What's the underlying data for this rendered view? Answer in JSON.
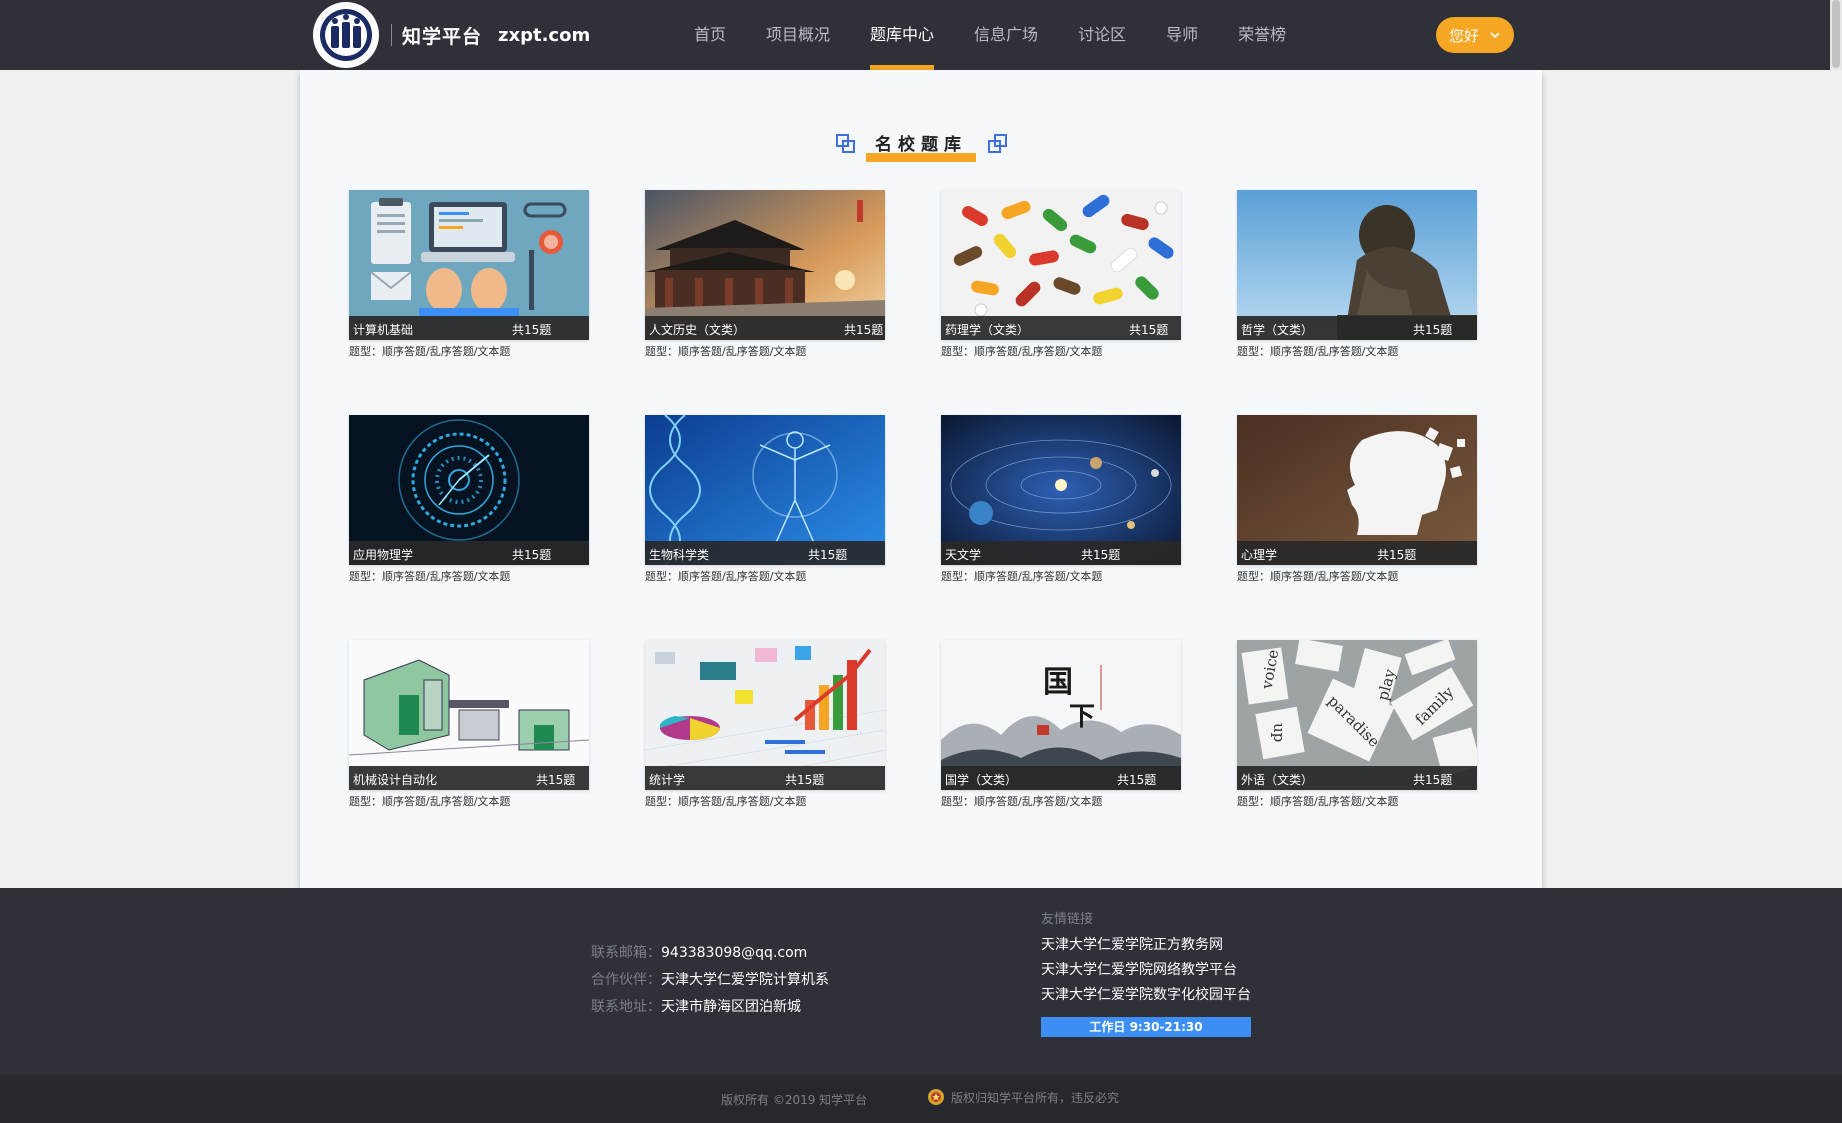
{
  "site": {
    "name": "知学平台",
    "domain": "zxpt.com"
  },
  "nav": {
    "items": [
      {
        "label": "首页",
        "active": false
      },
      {
        "label": "项目概况",
        "active": false
      },
      {
        "label": "题库中心",
        "active": true
      },
      {
        "label": "信息广场",
        "active": false
      },
      {
        "label": "讨论区",
        "active": false
      },
      {
        "label": "导师",
        "active": false
      },
      {
        "label": "荣誉榜",
        "active": false
      }
    ],
    "user_greeting": "您好"
  },
  "section": {
    "title": "名校题库"
  },
  "cards": [
    {
      "name": "计算机基础",
      "count": "共15题",
      "types": "题型：顺序答题/乱序答题/文本题",
      "image": "computer-illustration"
    },
    {
      "name": "人文历史（文类）",
      "count": "共15题",
      "types": "题型：顺序答题/乱序答题/文本题",
      "image": "ancient-tower-photo"
    },
    {
      "name": "药理学（文类）",
      "count": "共15题",
      "types": "题型：顺序答题/乱序答题/文本题",
      "image": "pills-photo"
    },
    {
      "name": "哲学（文类）",
      "count": "共15题",
      "types": "题型：顺序答题/乱序答题/文本题",
      "image": "thinker-statue-photo"
    },
    {
      "name": "应用物理学",
      "count": "共15题",
      "types": "题型：顺序答题/乱序答题/文本题",
      "image": "blue-clock-rings"
    },
    {
      "name": "生物科学类",
      "count": "共15题",
      "types": "题型：顺序答题/乱序答题/文本题",
      "image": "dna-human-figure"
    },
    {
      "name": "天文学",
      "count": "共15题",
      "types": "题型：顺序答题/乱序答题/文本题",
      "image": "solar-system"
    },
    {
      "name": "心理学",
      "count": "共15题",
      "types": "题型：顺序答题/乱序答题/文本题",
      "image": "puzzle-head"
    },
    {
      "name": "机械设计自动化",
      "count": "共15题",
      "types": "题型：顺序答题/乱序答题/文本题",
      "image": "machine-model"
    },
    {
      "name": "统计学",
      "count": "共15题",
      "types": "题型：顺序答题/乱序答题/文本题",
      "image": "charts-3d"
    },
    {
      "name": "国学（文类）",
      "count": "共15题",
      "types": "题型：顺序答题/乱序答题/文本题",
      "image": "ink-mountains-calligraphy"
    },
    {
      "name": "外语（文类）",
      "count": "共15题",
      "types": "题型：顺序答题/乱序答题/文本题",
      "image": "word-cards"
    }
  ],
  "footer": {
    "contact": [
      {
        "label": "联系邮箱：",
        "value": "943383098@qq.com"
      },
      {
        "label": "合作伙伴：",
        "value": "天津大学仁爱学院计算机系"
      },
      {
        "label": "联系地址：",
        "value": "天津市静海区团泊新城"
      }
    ],
    "links_title": "友情链接",
    "links": [
      "天津大学仁爱学院正方教务网",
      "天津大学仁爱学院网络教学平台",
      "天津大学仁爱学院数字化校园平台"
    ],
    "hours": "工作日 9:30-21:30",
    "copyright": "版权所有 ©2019 知学平台",
    "notice": "版权归知学平台所有，违反必究"
  },
  "colors": {
    "header_bg": "#2e3138",
    "accent": "#f5a623",
    "hours_bg": "#3d8ff5",
    "panel_bg": "#f6f9fc"
  }
}
